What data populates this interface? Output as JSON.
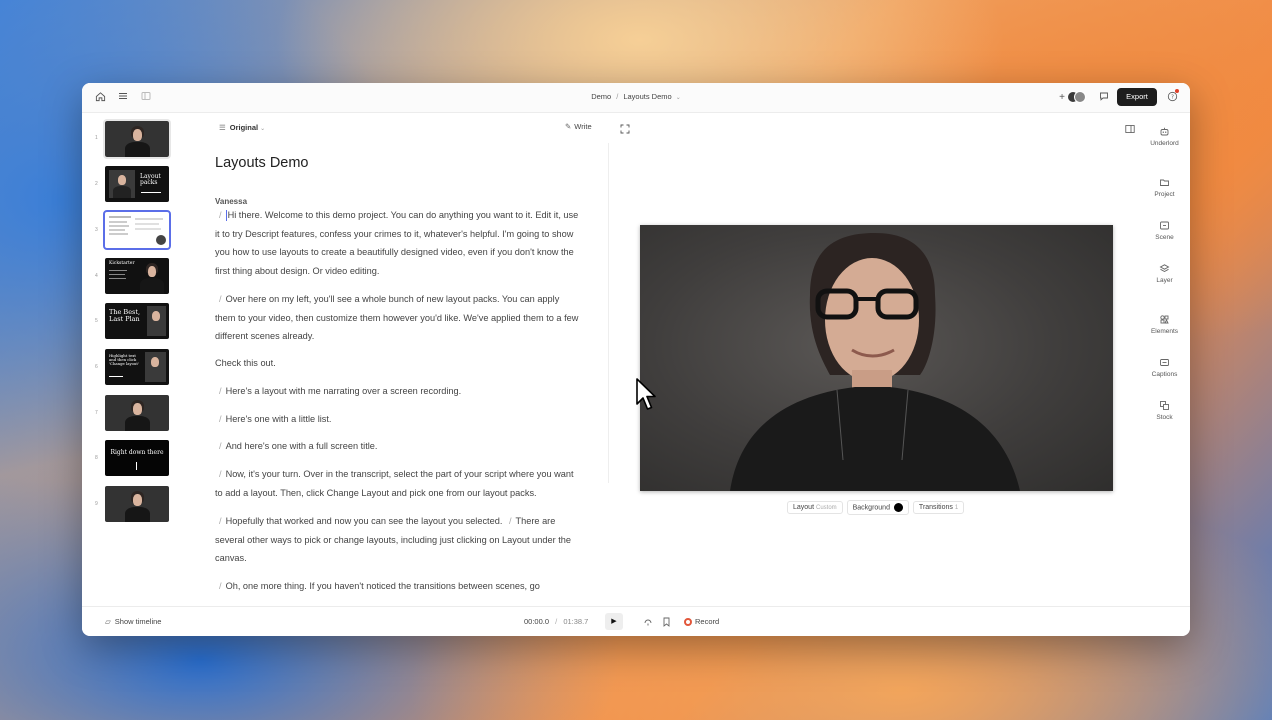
{
  "titlebar": {
    "breadcrumb_project": "Demo",
    "breadcrumb_separator": "/",
    "breadcrumb_composition": "Layouts Demo",
    "export_label": "Export",
    "plus_label": "+"
  },
  "scenes": {
    "items": [
      {
        "number": "1",
        "kind": "speaker"
      },
      {
        "number": "2",
        "kind": "title",
        "text": "Layout packs"
      },
      {
        "number": "3",
        "kind": "screen"
      },
      {
        "number": "4",
        "kind": "list",
        "text": "Kickstarter"
      },
      {
        "number": "5",
        "kind": "title",
        "text": "The Best, Last Plan"
      },
      {
        "number": "6",
        "kind": "title",
        "text": "Highlight text and then click 'Change layout'"
      },
      {
        "number": "7",
        "kind": "speaker"
      },
      {
        "number": "8",
        "kind": "title",
        "text": "Right down there"
      },
      {
        "number": "9",
        "kind": "speaker"
      }
    ]
  },
  "transcript": {
    "mode_label": "Original",
    "write_label": "Write",
    "title": "Layouts Demo",
    "speaker": "Vanessa",
    "paragraphs": [
      "Hi there. Welcome to this demo project. You can do anything you want to it. Edit it, use it to try Descript features, confess your crimes to it, whatever's helpful. I'm going to show you how to use layouts to create a beautifully designed video, even if you don't know the first thing about design. Or video editing.",
      "Over here on my left, you'll see a whole bunch of new layout packs. You can apply them to your video, then customize them however you'd like. We've applied them to a few different scenes already.",
      "Check this out.",
      "Here's a layout with me narrating over a screen recording.",
      "Here's one with a little list.",
      "And here's one with a full screen title.",
      "Now, it's your turn. Over in the transcript, select the part of your script where you want to add a layout. Then, click Change Layout and pick one from our layout packs.",
      "Hopefully that worked and now you can see the layout you selected.",
      "There are several other ways to pick or change layouts, including just clicking on Layout under the canvas.",
      "Oh, one more thing. If you haven't noticed the transitions between scenes, go"
    ]
  },
  "preview": {
    "layout_label": "Layout",
    "layout_value": "Custom",
    "background_label": "Background",
    "transitions_label": "Transitions",
    "transitions_count": "1",
    "background_color": "#000000"
  },
  "rail": {
    "items": [
      {
        "label": "Underlord",
        "icon": "robot-icon"
      },
      {
        "label": "Project",
        "icon": "folder-icon"
      },
      {
        "label": "Scene",
        "icon": "scene-icon"
      },
      {
        "label": "Layer",
        "icon": "layers-icon"
      },
      {
        "label": "Elements",
        "icon": "elements-icon"
      },
      {
        "label": "Captions",
        "icon": "captions-icon"
      },
      {
        "label": "Stock",
        "icon": "stock-icon"
      }
    ]
  },
  "bottombar": {
    "show_timeline": "Show timeline",
    "current_time": "00:00.0",
    "time_separator": "/",
    "total_time": "01:38.7",
    "record_label": "Record"
  },
  "colors": {
    "accent": "#5b6ee8",
    "record": "#e2573b",
    "export_bg": "#1d1d1d"
  }
}
